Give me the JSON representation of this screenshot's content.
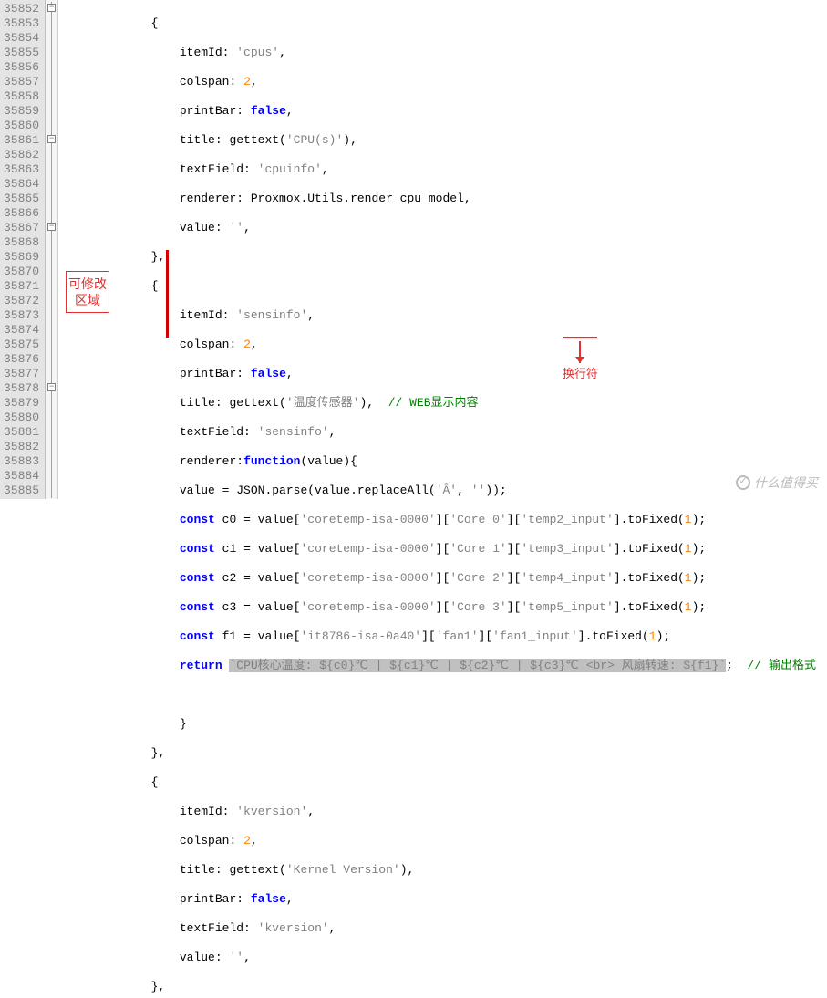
{
  "gutter_start": 35852,
  "gutter_end": 35885,
  "annotations": {
    "left_box_l1": "可修改",
    "left_box_l2": "区域",
    "newline_label": "换行符"
  },
  "watermark": "什么值得买",
  "code": {
    "l35852": "            {",
    "l35853_a": "                itemId: ",
    "l35853_b": "'cpus'",
    "l35853_c": ",",
    "l35854_a": "                colspan: ",
    "l35854_b": "2",
    "l35854_c": ",",
    "l35855_a": "                printBar: ",
    "l35855_b": "false",
    "l35855_c": ",",
    "l35856_a": "                title: gettext(",
    "l35856_b": "'CPU(s)'",
    "l35856_c": "),",
    "l35857_a": "                textField: ",
    "l35857_b": "'cpuinfo'",
    "l35857_c": ",",
    "l35858": "                renderer: Proxmox.Utils.render_cpu_model,",
    "l35859_a": "                value: ",
    "l35859_b": "''",
    "l35859_c": ",",
    "l35860": "            },",
    "l35861": "            {",
    "l35862_a": "                itemId: ",
    "l35862_b": "'sensinfo'",
    "l35862_c": ",",
    "l35863_a": "                colspan: ",
    "l35863_b": "2",
    "l35863_c": ",",
    "l35864_a": "                printBar: ",
    "l35864_b": "false",
    "l35864_c": ",",
    "l35865_a": "                title: gettext(",
    "l35865_b": "'温度传感器'",
    "l35865_c": "),  ",
    "l35865_d": "// WEB显示内容",
    "l35866_a": "                textField: ",
    "l35866_b": "'sensinfo'",
    "l35866_c": ",",
    "l35867_a": "                renderer:",
    "l35867_b": "function",
    "l35867_c": "(value){",
    "l35868_a": "                value = JSON.parse(value.replaceAll(",
    "l35868_b": "'Â'",
    "l35868_c": ", ",
    "l35868_d": "''",
    "l35868_e": "));",
    "l35869_a": "                ",
    "l35869_b": "const",
    "l35869_c": " c0 = value[",
    "l35869_d": "'coretemp-isa-0000'",
    "l35869_e": "][",
    "l35869_f": "'Core 0'",
    "l35869_g": "][",
    "l35869_h": "'temp2_input'",
    "l35869_i": "].toFixed(",
    "l35869_j": "1",
    "l35869_k": ");",
    "l35870_a": "                ",
    "l35870_b": "const",
    "l35870_c": " c1 = value[",
    "l35870_d": "'coretemp-isa-0000'",
    "l35870_e": "][",
    "l35870_f": "'Core 1'",
    "l35870_g": "][",
    "l35870_h": "'temp3_input'",
    "l35870_i": "].toFixed(",
    "l35870_j": "1",
    "l35870_k": ");",
    "l35871_a": "                ",
    "l35871_b": "const",
    "l35871_c": " c2 = value[",
    "l35871_d": "'coretemp-isa-0000'",
    "l35871_e": "][",
    "l35871_f": "'Core 2'",
    "l35871_g": "][",
    "l35871_h": "'temp4_input'",
    "l35871_i": "].toFixed(",
    "l35871_j": "1",
    "l35871_k": ");",
    "l35872_a": "                ",
    "l35872_b": "const",
    "l35872_c": " c3 = value[",
    "l35872_d": "'coretemp-isa-0000'",
    "l35872_e": "][",
    "l35872_f": "'Core 3'",
    "l35872_g": "][",
    "l35872_h": "'temp5_input'",
    "l35872_i": "].toFixed(",
    "l35872_j": "1",
    "l35872_k": ");",
    "l35873_a": "                ",
    "l35873_b": "const",
    "l35873_c": " f1 = value[",
    "l35873_d": "'it8786-isa-0a40'",
    "l35873_e": "][",
    "l35873_f": "'fan1'",
    "l35873_g": "][",
    "l35873_h": "'fan1_input'",
    "l35873_i": "].toFixed(",
    "l35873_j": "1",
    "l35873_k": ");",
    "l35874_a": "                ",
    "l35874_b": "return",
    "l35874_c": " ",
    "l35874_d": "`CPU核心温度: ${c0}℃ | ${c1}℃ | ${c2}℃ | ${c3}℃ <br> 风扇转速: ${f1}`",
    "l35874_e": ";  ",
    "l35874_f": "// 输出格式",
    "l35875": "",
    "l35876": "                }",
    "l35877": "            },",
    "l35878": "            {",
    "l35879_a": "                itemId: ",
    "l35879_b": "'kversion'",
    "l35879_c": ",",
    "l35880_a": "                colspan: ",
    "l35880_b": "2",
    "l35880_c": ",",
    "l35881_a": "                title: gettext(",
    "l35881_b": "'Kernel Version'",
    "l35881_c": "),",
    "l35882_a": "                printBar: ",
    "l35882_b": "false",
    "l35882_c": ",",
    "l35883_a": "                textField: ",
    "l35883_b": "'kversion'",
    "l35883_c": ",",
    "l35884_a": "                value: ",
    "l35884_b": "''",
    "l35884_c": ",",
    "l35885": "            },"
  }
}
